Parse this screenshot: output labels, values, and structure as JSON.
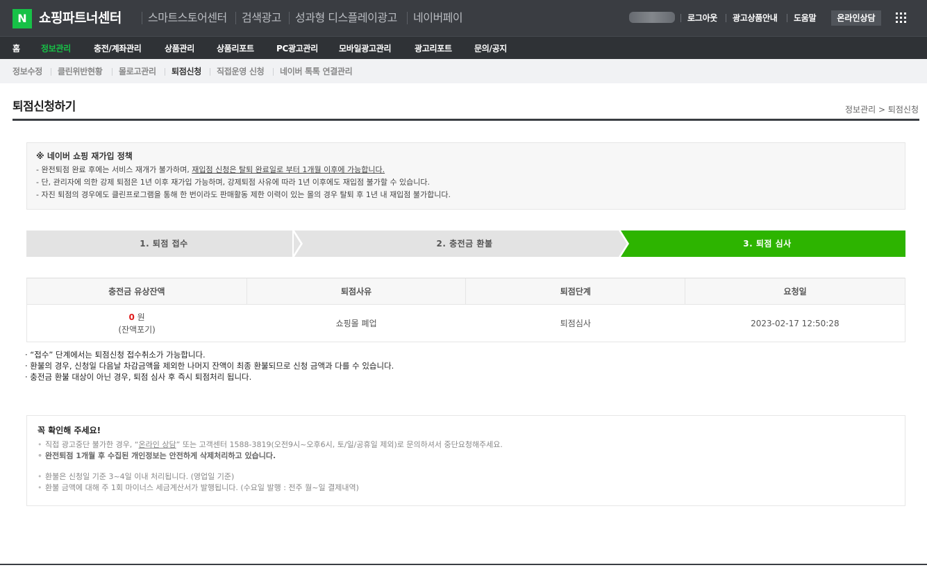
{
  "header": {
    "logo_letter": "N",
    "brand": "쇼핑파트너센터",
    "services": [
      "스마트스토어센터",
      "검색광고",
      "성과형 디스플레이광고",
      "네이버페이"
    ],
    "links": [
      "로그아웃",
      "광고상품안내",
      "도움말"
    ],
    "consult_button": "온라인상담"
  },
  "main_nav": {
    "items": [
      "홈",
      "정보관리",
      "충전/계좌관리",
      "상품관리",
      "상품리포트",
      "PC광고관리",
      "모바일광고관리",
      "광고리포트",
      "문의/공지"
    ],
    "active_index": 1
  },
  "sub_nav": {
    "items": [
      "정보수정",
      "클린위반현황",
      "몰로고관리",
      "퇴점신청",
      "직접운영 신청",
      "네이버 톡톡 연결관리"
    ],
    "active_index": 3
  },
  "page": {
    "title": "퇴점신청하기",
    "breadcrumb": "정보관리 > 퇴점신청"
  },
  "notice": {
    "heading": "※ 네이버 쇼핑 재가입 정책",
    "line1_prefix": "- 완전퇴점 완료 후에는 서비스 재개가 불가하며, ",
    "line1_underlined": "재입점 신청은 탈퇴 완료일로 부터 1개월 이후에 가능합니다.",
    "line2": "- 단, 관리자에 의한 강제 퇴점은 1년 이후 재가입 가능하며, 강제퇴점 사유에 따라 1년 이후에도 재입점 불가할 수 있습니다.",
    "line3": "- 자진 퇴점의 경우에도 클린프로그램을 통해 한 번이라도 판매활동 제한 이력이 있는 몰의 경우 탈퇴 후 1년 내 재입점 불가합니다."
  },
  "steps": {
    "items": [
      "1. 퇴점 접수",
      "2. 충전금 환불",
      "3. 퇴점 심사"
    ],
    "active_index": 2,
    "colors": {
      "inactive": "#e3e3e3",
      "active": "#2db400"
    }
  },
  "table": {
    "headers": [
      "충전금 유상잔액",
      "퇴점사유",
      "퇴점단계",
      "요청일"
    ],
    "row": {
      "amount": "0",
      "amount_unit": " 원",
      "amount_note": "(잔액포기)",
      "reason": "쇼핑몰 폐업",
      "stage": "퇴점심사",
      "date": "2023-02-17 12:50:28"
    }
  },
  "notes": [
    "· “접수” 단계에서는 퇴점신청 접수취소가 가능합니다.",
    "· 환불의 경우, 신청일 다음날 차감금액을 제외한 나머지 잔액이 최종 환불되므로 신청 금액과 다를 수 있습니다.",
    "· 충전금 환불 대상이 아닌 경우, 퇴점 심사 후 즉시 퇴점처리 됩니다."
  ],
  "check": {
    "heading": "꼭 확인해 주세요!",
    "item1_prefix": "직접 광고중단 불가한 경우, “",
    "item1_link": "온라인 상담",
    "item1_suffix": "” 또는 고객센터 1588-3819(오전9시~오후6시, 토/일/공휴일 제외)로 문의하셔서 중단요청해주세요.",
    "item2": "완전퇴점 1개월 후 수집된 개인정보는 안전하게 삭제처리하고 있습니다.",
    "item3": "환불은 신청일 기준 3~4일 이내 처리됩니다. (영업일 기준)",
    "item4": "환불 금액에 대해 주 1회 마이너스 세금계산서가 발행됩니다. (수요일 발행 : 전주 월~일 결제내역)"
  }
}
